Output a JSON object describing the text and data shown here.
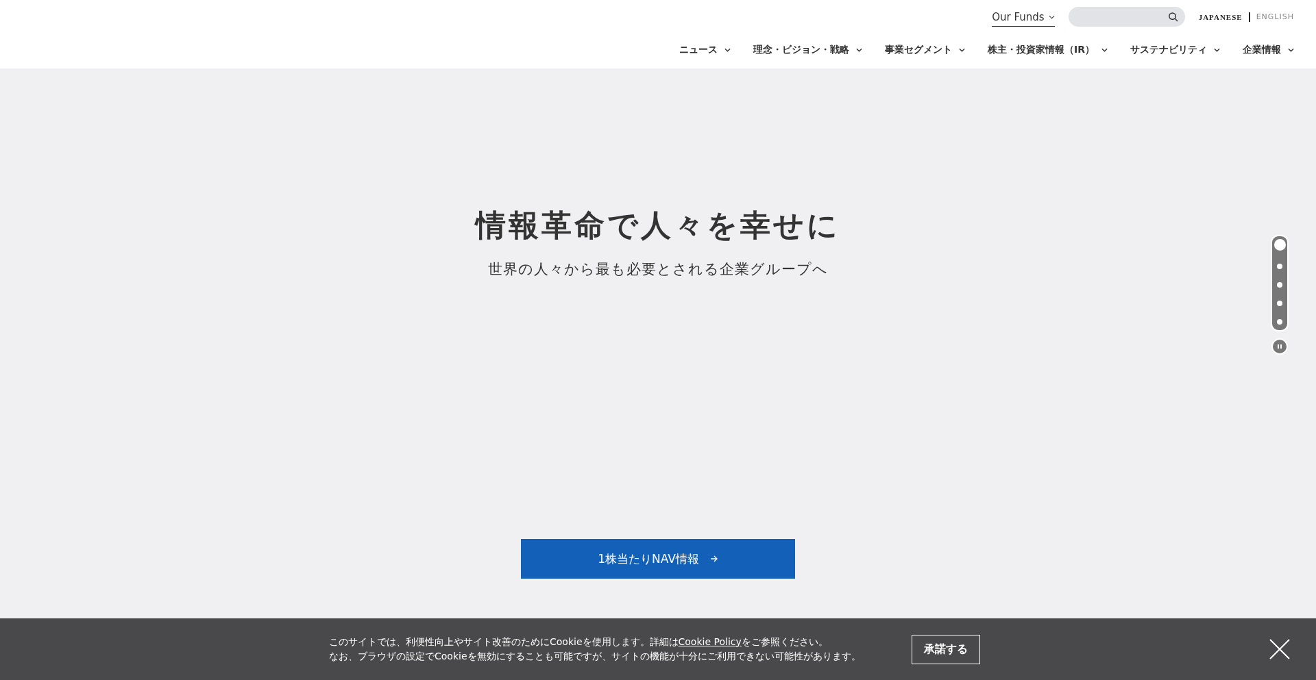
{
  "header": {
    "our_funds": "Our Funds",
    "search": {
      "kind": "search"
    },
    "languages": [
      {
        "label": "JAPANESE",
        "selected": true
      },
      {
        "label": "ENGLISH",
        "selected": false
      }
    ],
    "nav": [
      {
        "label": "ニュース"
      },
      {
        "label": "理念・ビジョン・戦略"
      },
      {
        "label": "事業セグメント"
      },
      {
        "label": "株主・投資家情報（IR）"
      },
      {
        "label": "サステナビリティ"
      },
      {
        "label": "企業情報"
      }
    ]
  },
  "hero": {
    "title": "情報革命で人々を幸せに",
    "subtitle": "世界の人々から最も必要とされる企業グループへ",
    "slides": [
      {
        "selected": true
      },
      {
        "selected": false
      },
      {
        "selected": false
      },
      {
        "selected": false
      },
      {
        "selected": false
      }
    ],
    "cta": "1株当たりNAV情報"
  },
  "cookie": {
    "line1_before": "このサイトでは、利便性向上やサイト改善のためにCookieを使用します。詳細は",
    "link": "Cookie Policy",
    "line1_after": "をご参照ください。",
    "line2": "なお、ブラウザの設定でCookieを無効にすることも可能ですが、サイトの機能が十分にご利用できない可能性があります。",
    "accept": "承諾する"
  }
}
